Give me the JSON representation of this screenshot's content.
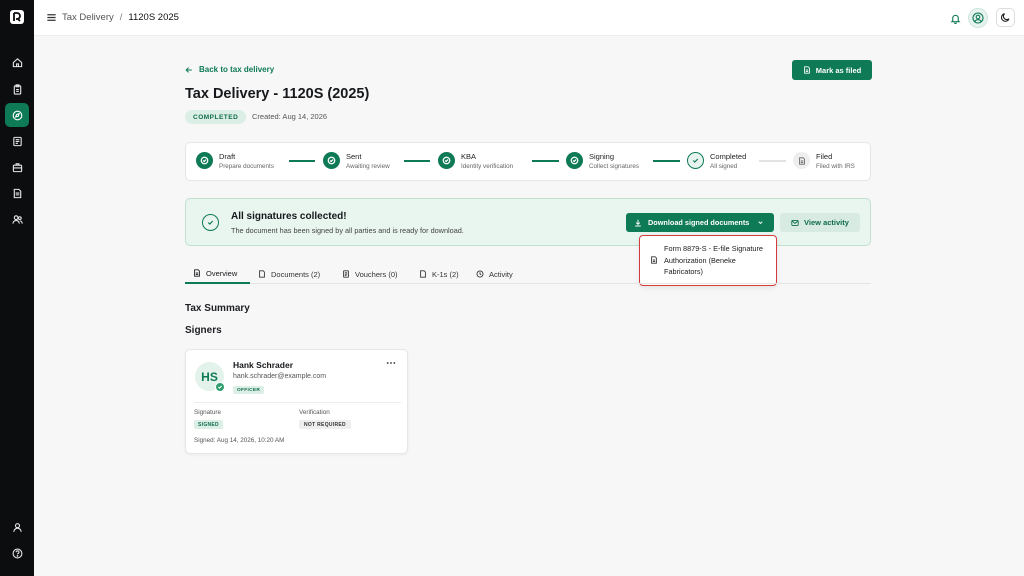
{
  "app": {
    "accent_color": "#0f7a56",
    "rail_color": "#0c0d0f"
  },
  "sidebar": {
    "items": [
      {
        "icon": "home-icon"
      },
      {
        "icon": "clipboard-icon"
      },
      {
        "icon": "compass-icon",
        "active": true
      },
      {
        "icon": "document-list-icon"
      },
      {
        "icon": "briefcase-icon"
      },
      {
        "icon": "file-text-icon"
      },
      {
        "icon": "users-icon"
      }
    ],
    "bottom": [
      {
        "icon": "user-icon"
      },
      {
        "icon": "help-icon"
      }
    ]
  },
  "header": {
    "breadcrumb_parent": "Tax Delivery",
    "breadcrumb_sep": "/",
    "breadcrumb_current": "1120S 2025",
    "icons": [
      "bell-icon",
      "user-circle-icon",
      "moon-icon"
    ]
  },
  "page": {
    "back_label": "Back to tax delivery",
    "title": "Tax Delivery - 1120S (2025)",
    "mark_filed_label": "Mark as filed",
    "status": "COMPLETED",
    "created": "Created: Aug 14, 2026"
  },
  "stepper": {
    "steps": [
      {
        "label": "Draft",
        "sub": "Prepare documents",
        "state": "done"
      },
      {
        "label": "Sent",
        "sub": "Awaiting review",
        "state": "done"
      },
      {
        "label": "KBA",
        "sub": "Identity verification",
        "state": "done"
      },
      {
        "label": "Signing",
        "sub": "Collect signatures",
        "state": "done"
      },
      {
        "label": "Completed",
        "sub": "All signed",
        "state": "current"
      },
      {
        "label": "Filed",
        "sub": "Filed with IRS",
        "state": "todo"
      }
    ]
  },
  "banner": {
    "title": "All signatures collected!",
    "subtitle": "The document has been signed by all parties and is ready for download.",
    "download_label": "Download signed documents",
    "activity_label": "View activity"
  },
  "dropdown": {
    "items": [
      {
        "label": "Form 8879-S - E-file Signature Authorization (Beneke Fabricators)"
      }
    ]
  },
  "tabs": [
    {
      "label": "Overview",
      "active": true
    },
    {
      "label": "Documents (2)"
    },
    {
      "label": "Vouchers (0)"
    },
    {
      "label": "K-1s (2)"
    },
    {
      "label": "Activity"
    }
  ],
  "sections": {
    "summary": "Tax Summary",
    "signers": "Signers"
  },
  "signer": {
    "initials": "HS",
    "name": "Hank Schrader",
    "email": "hank.schrader@example.com",
    "role": "OFFICER",
    "signature_label": "Signature",
    "signature_value": "SIGNED",
    "verification_label": "Verification",
    "verification_value": "NOT REQUIRED",
    "signed_at": "Signed: Aug 14, 2026, 10:20 AM"
  }
}
